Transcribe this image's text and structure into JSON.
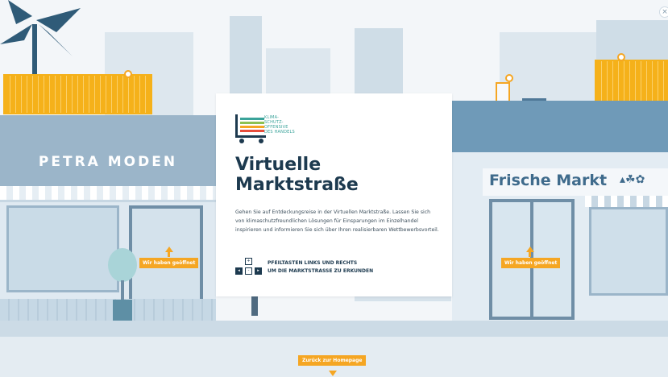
{
  "left_shop": {
    "sign": "PETRA MODEN",
    "status_badge": "Wir haben geöffnet"
  },
  "right_shop": {
    "sign": "Frische Markt",
    "status_badge": "Wir haben geöffnet"
  },
  "intro_card": {
    "logo_text": [
      "KLIMA-",
      "SCHUTZ-",
      "OFFENSIVE",
      "DES HANDELS"
    ],
    "title_line1": "Virtuelle",
    "title_line2": "Marktstraße",
    "description": "Gehen Sie auf Entdeckungsreise in der Virtuellen Marktstraße. Lassen Sie sich von klimaschutzfreundlichen Lösungen für Einsparungen im Einzelhandel inspirieren und informieren Sie sich über Ihren realisierbaren Wettbewerbsvorteil.",
    "keys_hint_line1": "PFEILTASTEN LINKS UND RECHTS",
    "keys_hint_line2": "UM DIE MARKTSTRASSE ZU ERKUNDEN"
  },
  "footer": {
    "home_link": "Zurück zur Homepage"
  },
  "colors": {
    "accent": "#f5a623",
    "title": "#1d3a4f",
    "logo": "#3aa39a"
  },
  "icons": [
    "palm-tree-icon",
    "solar-panel-icon",
    "arrow-up-icon",
    "arrow-down-icon",
    "keyboard-arrows-icon",
    "cart-logo-icon",
    "close-icon"
  ]
}
